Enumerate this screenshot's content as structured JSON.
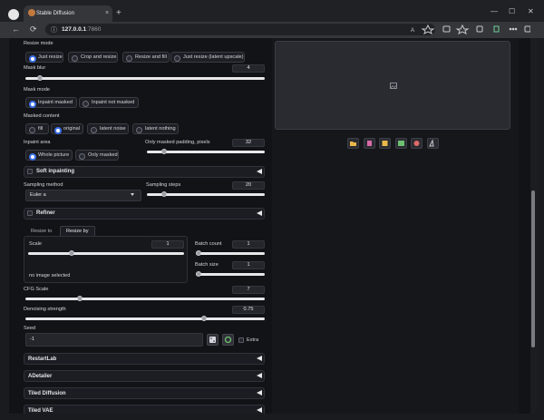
{
  "browser": {
    "tab_title": "Stable Diffusion",
    "url_host": "127.0.0.1",
    "url_port": ":7860",
    "back_icon": "←",
    "reload_icon": "⟳",
    "info_icon": "ⓘ",
    "close_tab": "×",
    "new_tab": "+",
    "min": "—",
    "max": "☐",
    "close": "✕"
  },
  "resize_mode": {
    "label": "Resize mode",
    "options": [
      "Just resize",
      "Crop and resize",
      "Resize and fill",
      "Just resize (latent upscale)"
    ],
    "selected": "Just resize"
  },
  "mask_blur": {
    "label": "Mask blur",
    "value": "4",
    "fraction": 0.05
  },
  "mask_mode": {
    "label": "Mask mode",
    "options": [
      "Inpaint masked",
      "Inpaint not masked"
    ],
    "selected": "Inpaint masked"
  },
  "masked_content": {
    "label": "Masked content",
    "options": [
      "fill",
      "original",
      "latent noise",
      "latent nothing"
    ],
    "selected": "original"
  },
  "inpaint_area": {
    "label": "Inpaint area",
    "options": [
      "Whole picture",
      "Only masked"
    ],
    "selected": "Whole picture"
  },
  "only_masked_padding": {
    "label": "Only masked padding, pixels",
    "value": "32",
    "fraction": 0.125
  },
  "soft_inpainting": {
    "label": "Soft inpainting"
  },
  "sampling_method": {
    "label": "Sampling method",
    "value": "Euler a"
  },
  "sampling_steps": {
    "label": "Sampling steps",
    "value": "20",
    "fraction": 0.13
  },
  "refiner": {
    "label": "Refiner"
  },
  "resize_tabs": [
    "Resize to",
    "Resize by"
  ],
  "scale": {
    "label": "Scale",
    "value": "1",
    "fraction": 0.27
  },
  "no_image": "no image selected",
  "batch_count": {
    "label": "Batch count",
    "value": "1",
    "fraction": 0.0
  },
  "batch_size": {
    "label": "Batch size",
    "value": "1",
    "fraction": 0.0
  },
  "cfg_scale": {
    "label": "CFG Scale",
    "value": "7",
    "fraction": 0.22
  },
  "denoising": {
    "label": "Denoising strength",
    "value": "0.75",
    "fraction": 0.75
  },
  "seed": {
    "label": "Seed",
    "value": "-1",
    "extra": "Extra"
  },
  "accordions": [
    "RestartLab",
    "ADetailer",
    "Tiled Diffusion",
    "Tiled VAE"
  ]
}
